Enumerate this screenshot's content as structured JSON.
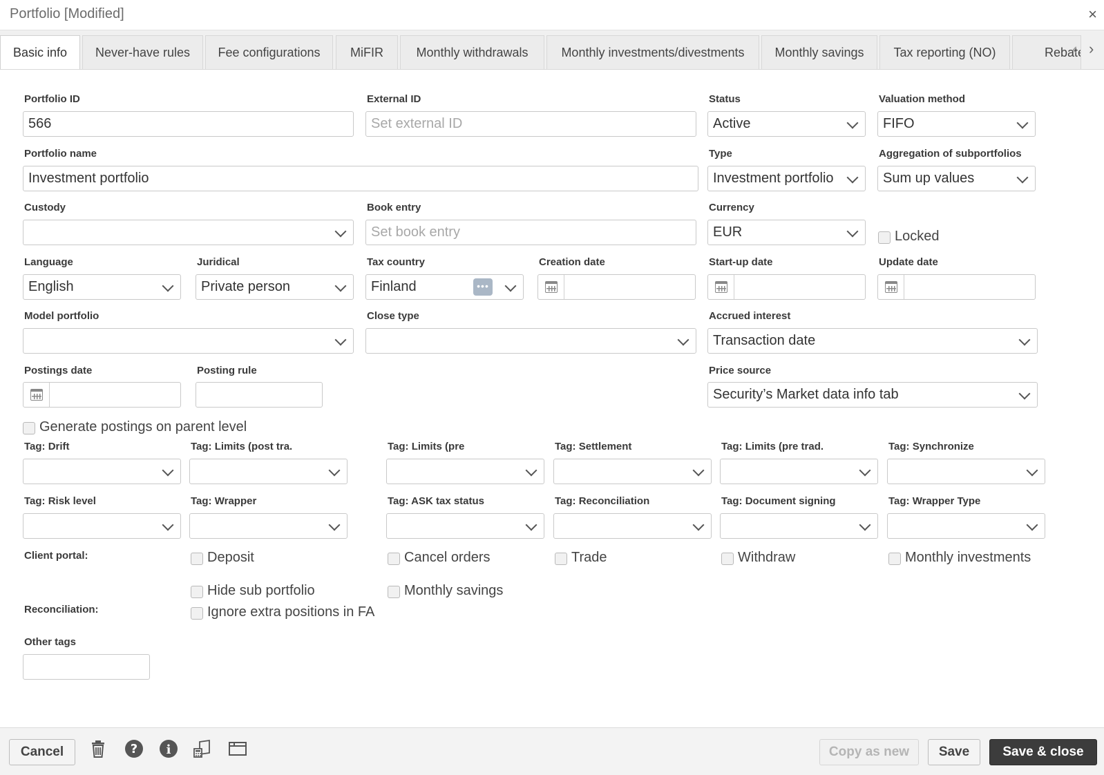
{
  "window": {
    "title": "Portfolio [Modified]",
    "close_glyph": "×"
  },
  "tabs": [
    {
      "label": "Basic info"
    },
    {
      "label": "Never-have rules"
    },
    {
      "label": "Fee configurations"
    },
    {
      "label": "MiFIR"
    },
    {
      "label": "Monthly withdrawals"
    },
    {
      "label": "Monthly investments/divestments"
    },
    {
      "label": "Monthly savings"
    },
    {
      "label": "Tax reporting (NO)"
    },
    {
      "label": "Rebate"
    }
  ],
  "form": {
    "portfolio_id": {
      "label": "Portfolio ID",
      "value": "566"
    },
    "external_id": {
      "label": "External ID",
      "placeholder": "Set external ID"
    },
    "status": {
      "label": "Status",
      "value": "Active"
    },
    "valuation_method": {
      "label": "Valuation method",
      "value": "FIFO"
    },
    "portfolio_name": {
      "label": "Portfolio name",
      "value": "Investment portfolio"
    },
    "type": {
      "label": "Type",
      "value": "Investment portfolio"
    },
    "aggregation": {
      "label": "Aggregation of subportfolios",
      "value": "Sum up values"
    },
    "custody": {
      "label": "Custody",
      "value": ""
    },
    "book_entry": {
      "label": "Book entry",
      "placeholder": "Set book entry"
    },
    "currency": {
      "label": "Currency",
      "value": "EUR"
    },
    "locked": {
      "label": "Locked"
    },
    "language": {
      "label": "Language",
      "value": "English"
    },
    "juridical": {
      "label": "Juridical",
      "value": "Private person"
    },
    "tax_country": {
      "label": "Tax country",
      "value": "Finland",
      "dots": "•••"
    },
    "creation_date": {
      "label": "Creation date"
    },
    "startup_date": {
      "label": "Start-up date"
    },
    "update_date": {
      "label": "Update date"
    },
    "model_portfolio": {
      "label": "Model portfolio"
    },
    "close_type": {
      "label": "Close type"
    },
    "accrued_interest": {
      "label": "Accrued interest",
      "value": "Transaction date"
    },
    "postings_date": {
      "label": "Postings date"
    },
    "posting_rule": {
      "label": "Posting rule"
    },
    "price_source": {
      "label": "Price source",
      "value": "Security’s Market data info tab"
    },
    "generate_postings": {
      "label": "Generate postings on parent level"
    }
  },
  "tags": [
    {
      "label": "Tag: Drift"
    },
    {
      "label": "Tag: Limits (post tra."
    },
    {
      "label": "Tag: Limits (pre"
    },
    {
      "label": "Tag: Settlement"
    },
    {
      "label": "Tag: Limits (pre trad."
    },
    {
      "label": "Tag: Synchronize"
    },
    {
      "label": "Tag: Risk level"
    },
    {
      "label": "Tag: Wrapper"
    },
    {
      "label": "Tag: ASK tax status"
    },
    {
      "label": "Tag: Reconciliation"
    },
    {
      "label": "Tag: Document signing"
    },
    {
      "label": "Tag: Wrapper Type"
    }
  ],
  "client_portal": {
    "label": "Client portal:",
    "options": [
      "Deposit",
      "Cancel orders",
      "Trade",
      "Withdraw",
      "Monthly investments",
      "Hide sub portfolio",
      "Monthly savings"
    ]
  },
  "reconciliation": {
    "label": "Reconciliation:",
    "option": "Ignore extra positions in FA"
  },
  "other_tags": {
    "label": "Other tags"
  },
  "footer": {
    "cancel": "Cancel",
    "copy_as_new": "Copy as new",
    "save": "Save",
    "save_close": "Save & close"
  },
  "colors": {
    "dark_button": "#3c3c3c",
    "placeholder": "#a8a8a8",
    "dots_badge": "#aab7c6"
  }
}
